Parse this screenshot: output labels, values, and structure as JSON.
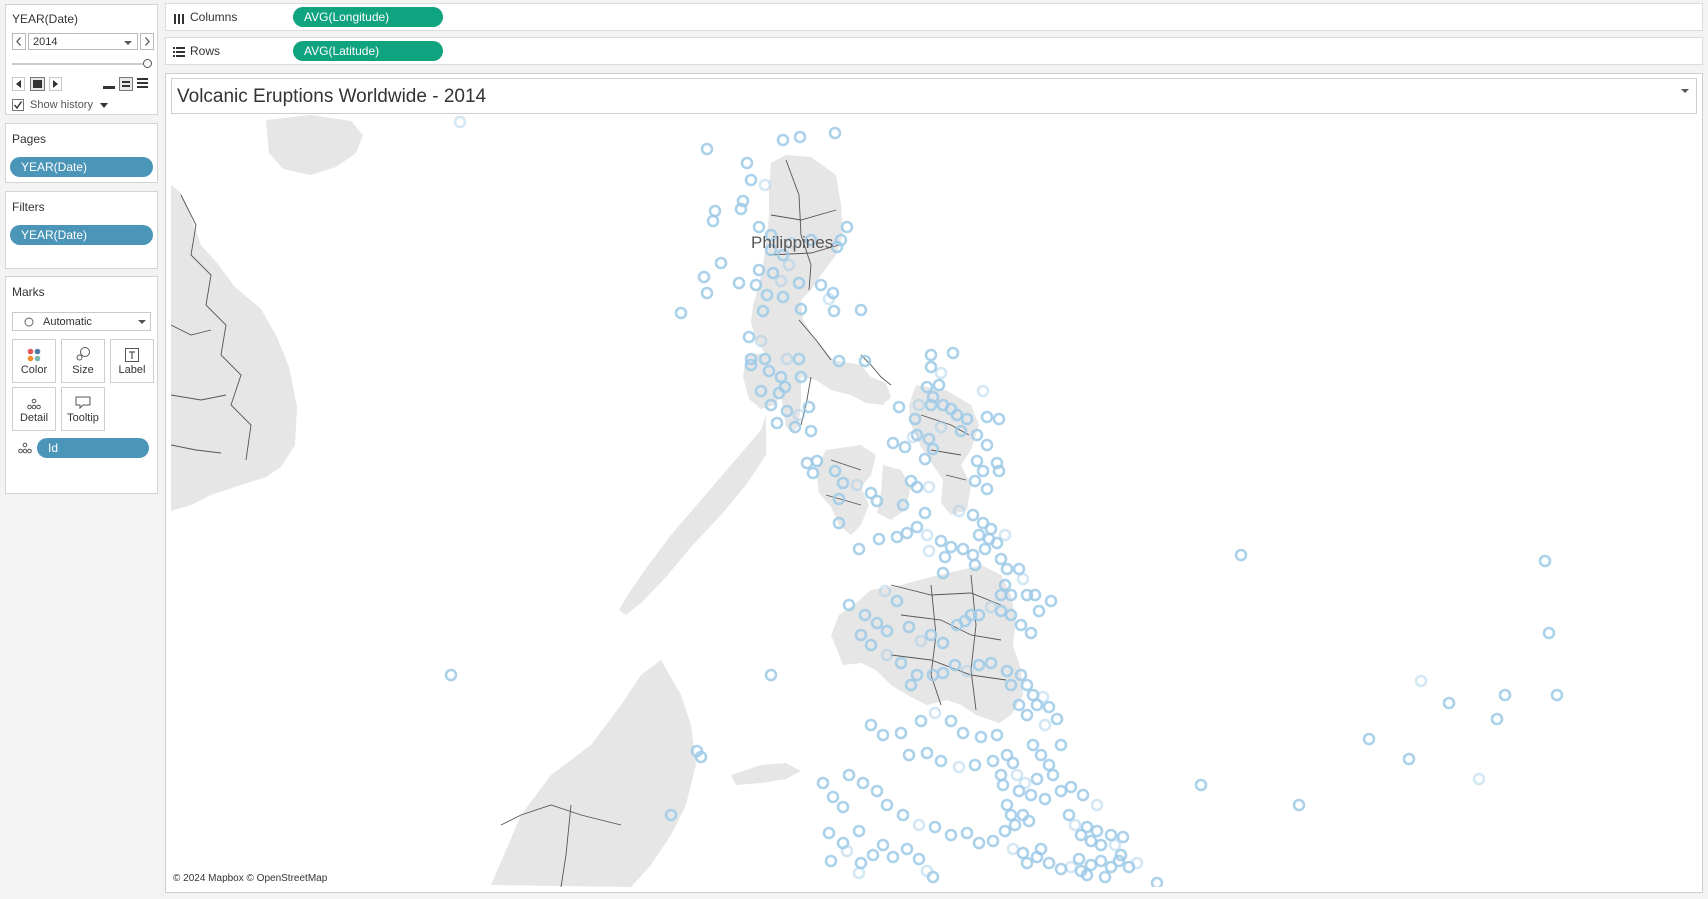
{
  "page_controls": {
    "field": "YEAR(Date)",
    "value": "2014",
    "show_history_label": "Show history",
    "show_history_checked": true
  },
  "pages": {
    "title": "Pages",
    "pill": "YEAR(Date)"
  },
  "filters": {
    "title": "Filters",
    "pill": "YEAR(Date)"
  },
  "marks": {
    "title": "Marks",
    "type": "Automatic",
    "buttons": {
      "color": "Color",
      "size": "Size",
      "label": "Label",
      "detail": "Detail",
      "tooltip": "Tooltip"
    },
    "detail_pill": "Id"
  },
  "shelves": {
    "columns_label": "Columns",
    "columns_pill": "AVG(Longitude)",
    "rows_label": "Rows",
    "rows_pill": "AVG(Latitude)"
  },
  "view": {
    "title": "Volcanic Eruptions Worldwide - 2014",
    "country_label": "Philippines",
    "attribution": "© 2024 Mapbox © OpenStreetMap"
  },
  "colors": {
    "pill_blue": "#4b95b8",
    "pill_green": "#10a37f",
    "mark": "#9ecae8",
    "land": "#e6e6e6"
  }
}
